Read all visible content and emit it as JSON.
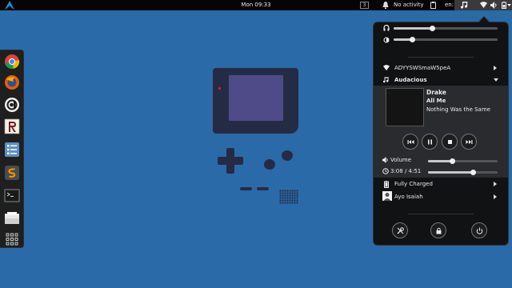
{
  "topbar": {
    "clock": "Mon 09:33",
    "workspace_number": "3",
    "notifications_label": "No activity",
    "input_language": "en"
  },
  "dock": {
    "apps": [
      "chromium-icon",
      "firefox-icon",
      "atom-icon",
      "rstudio-icon",
      "settings-list-icon",
      "sublime-text-icon",
      "terminal-icon",
      "files-icon",
      "app-grid-icon"
    ]
  },
  "system_menu": {
    "headphone_volume": 0.37,
    "brightness": 0.18,
    "wifi_network": "ADYYSWSmaW5peA",
    "media_player": "Audacious",
    "track": {
      "artist": "Drake",
      "title": "All Me",
      "album": "Nothing Was the Same"
    },
    "player_volume_label": "Volume",
    "player_volume": 0.35,
    "time_position": "3:08 / 4:51",
    "progress": 0.65,
    "battery": "Fully Charged",
    "user": "Ayo Isaiah"
  },
  "colors": {
    "desktop": "#2a6aa8",
    "gameboy_body": "#262b45",
    "gameboy_lcd": "#4f4b88",
    "menu_bg": "#111214"
  }
}
